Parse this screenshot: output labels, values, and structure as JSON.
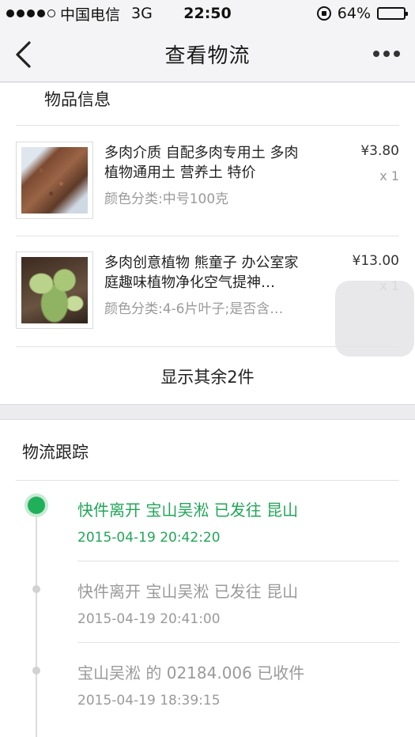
{
  "status_bar": {
    "carrier": "中国电信",
    "network": "3G",
    "time": "22:50",
    "battery": "64%",
    "battery_level": 0.64
  },
  "nav": {
    "title": "查看物流"
  },
  "goods": {
    "section_title": "物品信息",
    "items": [
      {
        "name": "多肉介质 自配多肉专用土 多肉植物通用土 营养土 特价",
        "spec": "颜色分类:中号100克",
        "price": "¥3.80",
        "qty": "x 1"
      },
      {
        "name": "多肉创意植物 熊童子 办公室家庭趣味植物净化空气提神…",
        "spec": "颜色分类:4-6片叶子;是否含…",
        "price": "¥13.00",
        "qty": "x 1"
      }
    ],
    "show_more": "显示其余2件"
  },
  "tracking": {
    "section_title": "物流跟踪",
    "events": [
      {
        "text": "快件离开 宝山吴淞 已发往 昆山",
        "time": "2015-04-19 20:42:20",
        "active": true
      },
      {
        "text": "快件离开 宝山吴淞 已发往 昆山",
        "time": "2015-04-19 20:41:00",
        "active": false
      },
      {
        "text": "宝山吴淞 的 02184.006 已收件",
        "time": "2015-04-19 18:39:15",
        "active": false
      }
    ]
  },
  "colors": {
    "accent_green": "#21a658",
    "muted_text": "#9a9a9a"
  }
}
